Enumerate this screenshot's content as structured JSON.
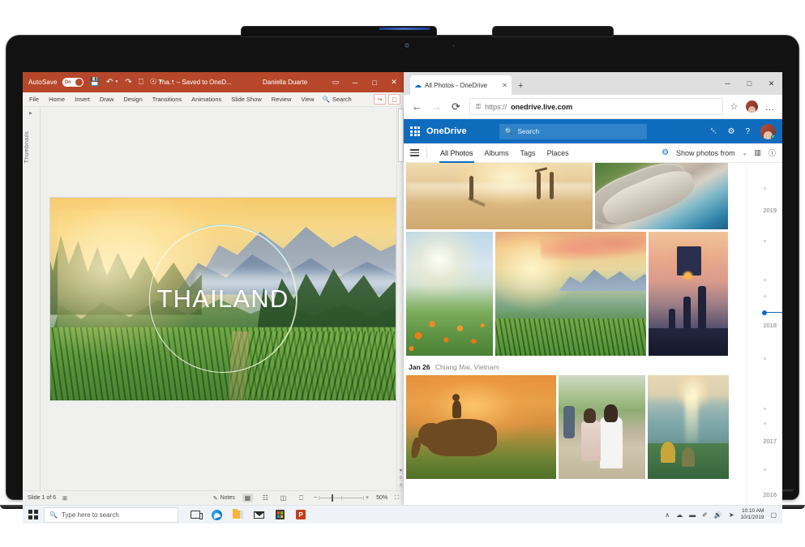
{
  "powerpoint": {
    "titlebar": {
      "autosave_label": "AutoSave",
      "autosave_state": "On",
      "filename": "Tha... – Saved to OneD...",
      "username": "Daniella Duarte",
      "icons": [
        "save-icon",
        "undo-icon",
        "redo-icon",
        "present-icon",
        "touch-mode-icon",
        "customize-icon"
      ],
      "ribbon_display_label": "▭",
      "minimize_label": "─",
      "maximize_label": "□",
      "close_label": "✕"
    },
    "ribbon": {
      "tabs": [
        "File",
        "Home",
        "Insert",
        "Draw",
        "Design",
        "Transitions",
        "Animations",
        "Slide Show",
        "Review",
        "View"
      ],
      "search_label": "Search",
      "share_label": "↪",
      "comments_label": "▢"
    },
    "thumbnails_pane_label": "Thumbnails",
    "slide": {
      "title": "THAILAND",
      "alt": "Sunrise over Thailand tea plantation terraces and misty mountains"
    },
    "status": {
      "slide_count_label": "Slide 1 of 6",
      "accessibility_label": "⊞",
      "notes_label": "Notes",
      "views": [
        "normal-view",
        "slide-sorter-view",
        "reading-view",
        "slide-show-view"
      ],
      "zoom_minus": "−",
      "zoom_plus": "+",
      "zoom_level": "50%",
      "fit_label": "⛶"
    }
  },
  "edge": {
    "tab": {
      "title": "All Photos - OneDrive",
      "close_label": "✕",
      "new_tab_label": "+"
    },
    "window_controls": {
      "minimize": "─",
      "maximize": "□",
      "close": "✕"
    },
    "toolbar": {
      "back_label": "←",
      "forward_label": "→",
      "refresh_label": "⟳",
      "lock_label": "⚿",
      "url_protocol": "https://",
      "url_host": "onedrive.live.com",
      "favorite_label": "☆",
      "more_label": "…"
    }
  },
  "onedrive": {
    "suite": {
      "brand": "OneDrive",
      "search_placeholder": "Search",
      "notification_label": "␇",
      "settings_label": "⚙",
      "help_label": "?"
    },
    "commandbar": {
      "nav_items": [
        "All Photos",
        "Albums",
        "Tags",
        "Places"
      ],
      "active_nav": "All Photos",
      "show_photos_from_label": "Show photos from",
      "chevron_label": "⌄",
      "layout_label": "▥",
      "info_label": "ⓘ"
    },
    "date_group": {
      "date": "Jan 26",
      "location": "Chiang Mai, Vietnam"
    },
    "photos": [
      {
        "name": "beach-sunset-surfers",
        "row": 1
      },
      {
        "name": "coastal-road-aerial",
        "row": 1
      },
      {
        "name": "marigold-flowers-sunrise",
        "row": 2
      },
      {
        "name": "mountain-tea-plantation-sunset",
        "row": 2
      },
      {
        "name": "sky-lantern-silhouettes",
        "row": 2
      },
      {
        "name": "elephant-rider-sunset",
        "row": 3
      },
      {
        "name": "hikers-on-trail",
        "row": 3
      },
      {
        "name": "cliff-ocean-sunset",
        "row": 3
      }
    ],
    "timeline": {
      "years": [
        "2019",
        "2018",
        "2017",
        "2016"
      ],
      "active_year": "2018",
      "accent_color": "#0f6cbd"
    }
  },
  "taskbar": {
    "search_placeholder": "Type here to search",
    "apps": [
      "task-view",
      "microsoft-edge",
      "file-explorer",
      "mail",
      "microsoft-store",
      "powerpoint"
    ],
    "tray": {
      "overflow_label": "∧",
      "onedrive_label": "☁",
      "battery_label": "▬",
      "pen_label": "✐",
      "volume_label": "ὐA",
      "network_label": "➿",
      "time": "10:10 AM",
      "date": "10/1/2019",
      "action_center_label": "▢"
    }
  },
  "colors": {
    "powerpoint_accent": "#b7472a",
    "onedrive_blue": "#0f6cbd",
    "taskbar": "#eff2f6"
  }
}
